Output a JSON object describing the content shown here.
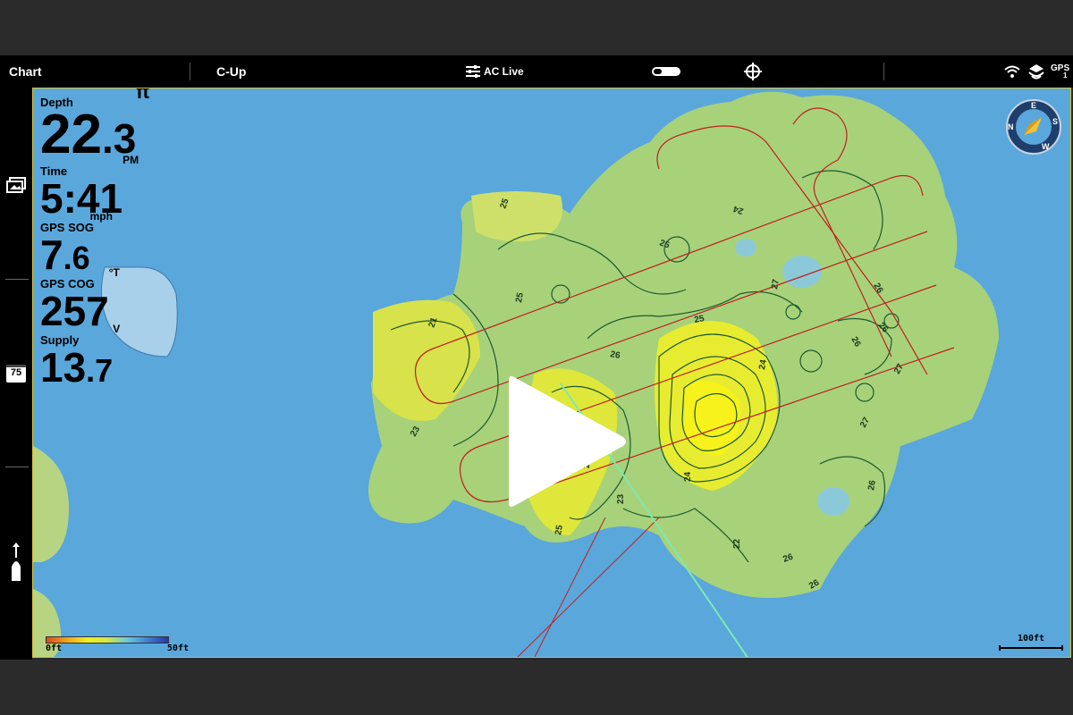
{
  "topbar": {
    "view_label": "Chart",
    "orientation_label": "C-Up",
    "ac_live_label": "AC Live",
    "gps_label": "GPS",
    "gps_sub": "1"
  },
  "readouts": {
    "depth": {
      "label": "Depth",
      "value_int": "22",
      "value_dec": ".3",
      "unit": "ft"
    },
    "time": {
      "label": "Time",
      "value": "5:41",
      "unit": "PM"
    },
    "sog": {
      "label": "GPS SOG",
      "value_int": "7",
      "value_dec": ".6",
      "unit": "mph"
    },
    "cog": {
      "label": "GPS COG",
      "value": "257",
      "unit": "°T"
    },
    "supply": {
      "label": "Supply",
      "value_int": "13",
      "value_dec": ".7",
      "unit": "V"
    }
  },
  "sidebar": {
    "temp_badge": "75"
  },
  "depth_scale": {
    "min_label": "0ft",
    "max_label": "50ft"
  },
  "distance_scale": {
    "label": "100ft"
  },
  "compass": {
    "n": "N",
    "e": "E",
    "s": "S",
    "w": "W"
  },
  "contour_labels": [
    "25",
    "25",
    "24",
    "21",
    "23",
    "25",
    "26",
    "26",
    "27",
    "25",
    "24",
    "23",
    "22",
    "23",
    "25",
    "24",
    "26",
    "26",
    "27",
    "26",
    "27",
    "26",
    "26",
    "22"
  ],
  "colors": {
    "water": "#5aa7dc",
    "shallow_green": "#a7d27a",
    "yellow": "#f2ef1e",
    "contour": "#1e5a2e",
    "track": "#c0201e"
  }
}
